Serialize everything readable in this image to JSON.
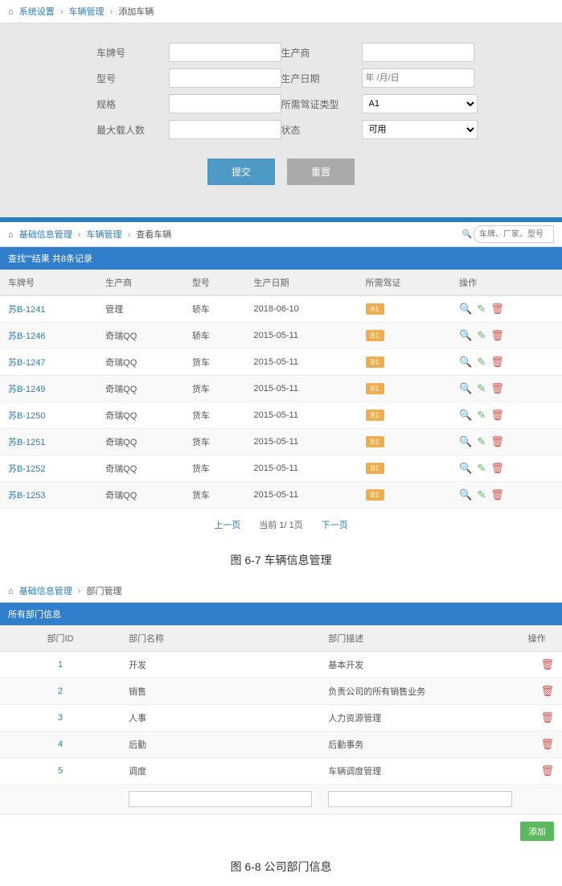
{
  "section1": {
    "breadcrumb": {
      "items": [
        "系统设置",
        "车辆管理",
        "添加车辆"
      ]
    },
    "form": {
      "plate_label": "车牌号",
      "manufacturer_label": "生产商",
      "model_label": "型号",
      "prod_date_label": "生产日期",
      "prod_date_placeholder": "年 /月/日",
      "spec_label": "规格",
      "license_type_label": "所需驾证类型",
      "license_type_value": "A1",
      "max_capacity_label": "最大载人数",
      "status_label": "状态",
      "status_value": "可用",
      "submit_btn": "提交",
      "reset_btn": "重置"
    }
  },
  "section2": {
    "breadcrumb": {
      "items": [
        "基础信息管理",
        "车辆管理",
        "查看车辆"
      ]
    },
    "search_placeholder": "车牌、厂家、型号",
    "result_header": "查找\"\"结果 共8条记录",
    "table": {
      "headers": [
        "车牌号",
        "生产商",
        "型号",
        "生产日期",
        "所需驾证",
        "操作"
      ],
      "rows": [
        {
          "plate": "苏B-1241",
          "manufacturer": "管理",
          "model": "轿车",
          "date": "2018-06-10",
          "license": "A1"
        },
        {
          "plate": "苏B-1246",
          "manufacturer": "奇瑞QQ",
          "model": "轿车",
          "date": "2015-05-11",
          "license": "B1"
        },
        {
          "plate": "苏B-1247",
          "manufacturer": "奇瑞QQ",
          "model": "货车",
          "date": "2015-05-11",
          "license": "B1"
        },
        {
          "plate": "苏B-1249",
          "manufacturer": "奇瑞QQ",
          "model": "货车",
          "date": "2015-05-11",
          "license": "B1"
        },
        {
          "plate": "苏B-1250",
          "manufacturer": "奇瑞QQ",
          "model": "货车",
          "date": "2015-05-11",
          "license": "B1"
        },
        {
          "plate": "苏B-1251",
          "manufacturer": "奇瑞QQ",
          "model": "货车",
          "date": "2015-05-11",
          "license": "B1"
        },
        {
          "plate": "苏B-1252",
          "manufacturer": "奇瑞QQ",
          "model": "货车",
          "date": "2015-05-11",
          "license": "B1"
        },
        {
          "plate": "苏B-1253",
          "manufacturer": "奇瑞QQ",
          "model": "货车",
          "date": "2015-05-11",
          "license": "B1"
        }
      ]
    },
    "pagination": {
      "prev": "上一页",
      "current": "当前 1/ 1页",
      "next": "下一页"
    },
    "caption": "图 6-7 车辆信息管理"
  },
  "section3": {
    "breadcrumb": {
      "items": [
        "基础信息管理",
        "部门管理"
      ]
    },
    "result_header": "所有部门信息",
    "table": {
      "headers": [
        "部门ID",
        "部门名称",
        "部门描述",
        "操作"
      ],
      "rows": [
        {
          "id": "1",
          "name": "开发",
          "desc": "基本开发"
        },
        {
          "id": "2",
          "name": "销售",
          "desc": "负责公司的所有销售业务"
        },
        {
          "id": "3",
          "name": "人事",
          "desc": "人力资源管理"
        },
        {
          "id": "4",
          "name": "后勤",
          "desc": "后勤事务"
        },
        {
          "id": "5",
          "name": "调度",
          "desc": "车辆调度管理"
        }
      ]
    },
    "add_btn": "添加",
    "caption": "图 6-8 公司部门信息"
  }
}
